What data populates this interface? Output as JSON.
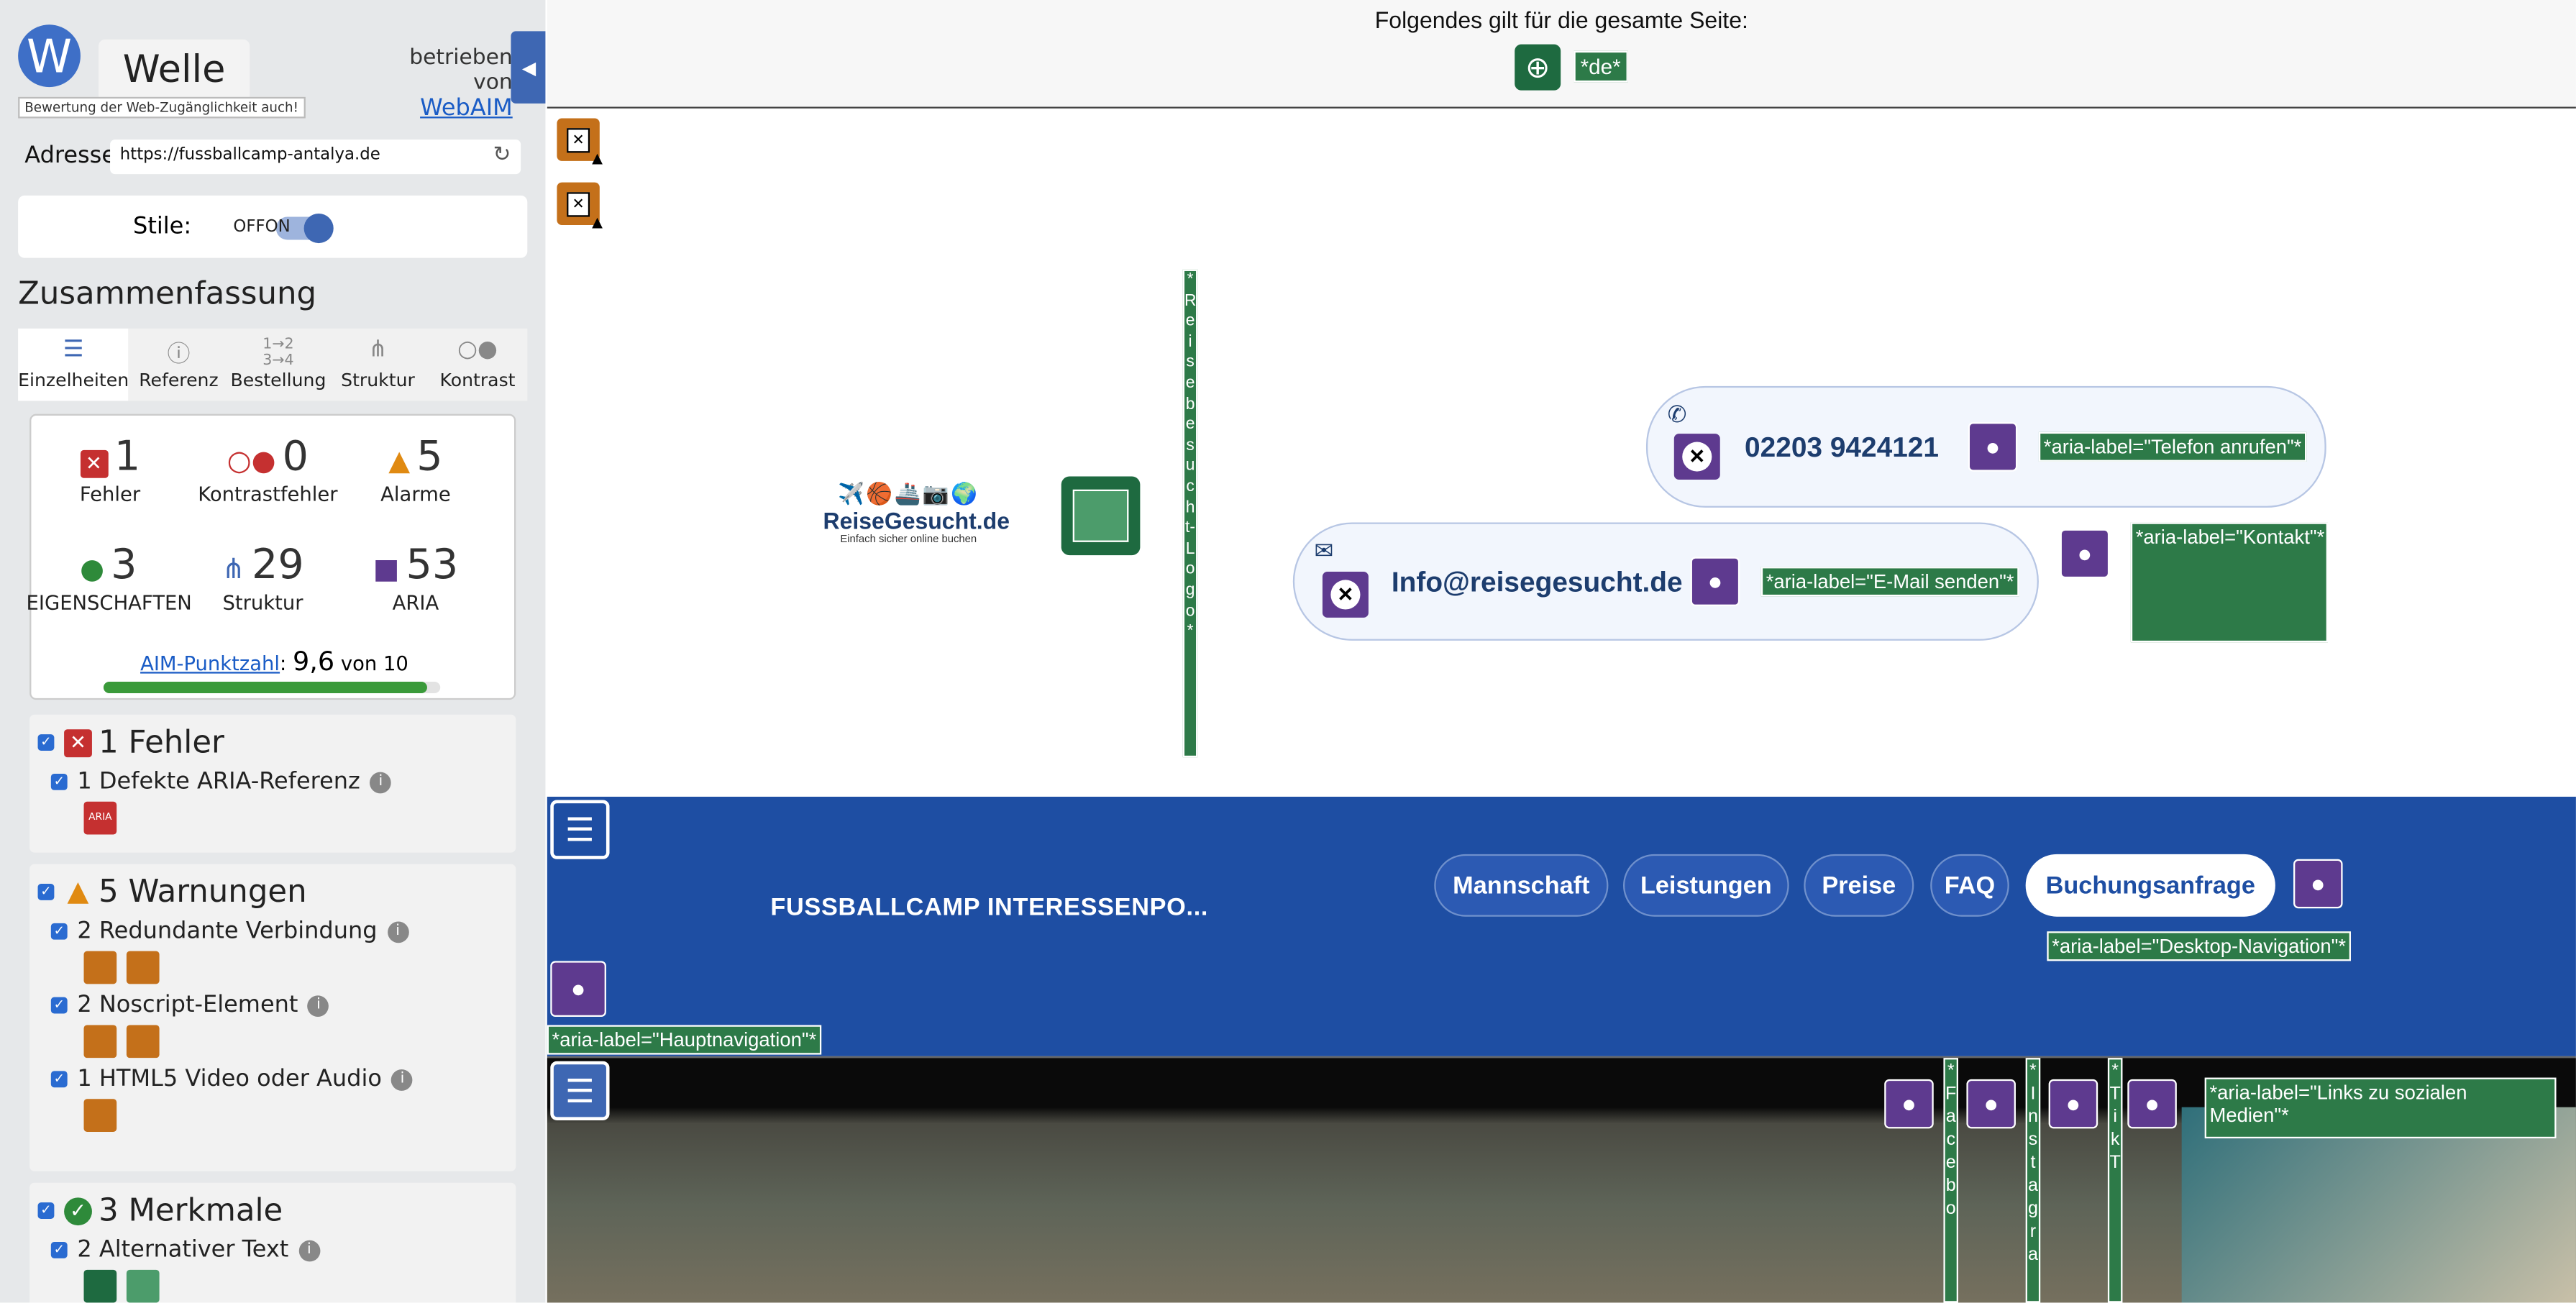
{
  "wave": {
    "title": "Welle",
    "tagline": "Bewertung der Web-Zugänglichkeit auch!",
    "powered_by": "betrieben von",
    "webaim_link": "WebAIM",
    "collapse": "◀"
  },
  "address": {
    "label": "Adresse:",
    "url": "https://fussballcamp-antalya.de"
  },
  "styles": {
    "label": "Stile:",
    "off": "OFF",
    "on": "ON"
  },
  "summary": {
    "heading": "Zusammenfassung",
    "tabs": [
      {
        "label": "Einzelheiten"
      },
      {
        "label": "Referenz"
      },
      {
        "label": "Bestellung"
      },
      {
        "label": "Struktur"
      },
      {
        "label": "Kontrast"
      }
    ],
    "stats": [
      {
        "count": "1",
        "label": "Fehler"
      },
      {
        "count": "0",
        "label": "Kontrastfehler"
      },
      {
        "count": "5",
        "label": "Alarme"
      },
      {
        "count": "3",
        "label": "EIGENSCHAFTEN"
      },
      {
        "count": "29",
        "label": "Struktur"
      },
      {
        "count": "53",
        "label": "ARIA"
      }
    ],
    "score_link": "AIM-Punktzahl",
    "score_value": "9,6",
    "score_of": "von 10",
    "score_fraction": 0.96
  },
  "details": {
    "errors": {
      "title": "1 Fehler",
      "items": [
        {
          "label": "1 Defekte ARIA-Referenz"
        }
      ]
    },
    "warnings": {
      "title": "5 Warnungen",
      "items": [
        {
          "label": "2 Redundante Verbindung"
        },
        {
          "label": "2 Noscript-Element"
        },
        {
          "label": "1 HTML5 Video oder Audio"
        }
      ]
    },
    "features": {
      "title": "3 Merkmale",
      "items": [
        {
          "label": "2 Alternativer Text"
        }
      ]
    }
  },
  "page": {
    "global_note": "Folgendes gilt für die gesamte Seite:",
    "lang": "*de*",
    "logo_alt": "*ReisebesuchtLogo*",
    "logo_alt_display": "*Reisebesucht-Logo*",
    "logo_name": "ReiseGesucht.de",
    "logo_sub": "Einfach sicher online buchen",
    "logo_emojis": "✈️🏀🚢📷🌍",
    "phone": "02203 9424121",
    "phone_aria": "*aria-label=\"Telefon anrufen\"*",
    "email": "Info@reisegesucht.de",
    "email_aria": "*aria-label=\"E-Mail senden\"*",
    "contact_aria": "*aria-label=\"Kontakt\"*",
    "brand": "FUSSBALLCAMP INTERESSENPO...",
    "nav": [
      {
        "label": "Mannschaft"
      },
      {
        "label": "Leistungen"
      },
      {
        "label": "Preise"
      },
      {
        "label": "FAQ"
      },
      {
        "label": "Buchungsanfrage"
      }
    ],
    "desktop_nav_aria": "*aria-label=\"Desktop-Navigation\"*",
    "main_nav_aria": "*aria-label=\"Hauptnavigation\"*",
    "social_aria": "*aria-label=\"Links zu sozialen Medien\"*",
    "social": [
      {
        "label": "*Facebo"
      },
      {
        "label": "*Instagra"
      },
      {
        "label": "*TikT"
      }
    ]
  },
  "colors": {
    "wave_blue": "#3e67b3",
    "site_blue": "#1e4ea3",
    "aria_green": "#2d7a48",
    "aria_purple": "#5e3a8f"
  }
}
